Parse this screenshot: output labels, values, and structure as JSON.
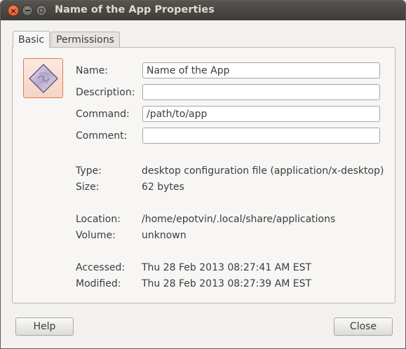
{
  "window": {
    "title": "Name of the App Properties"
  },
  "tabs": [
    {
      "label": "Basic",
      "active": true
    },
    {
      "label": "Permissions",
      "active": false
    }
  ],
  "basic": {
    "fields": {
      "name": {
        "label": "Name:",
        "value": "Name of the App"
      },
      "description": {
        "label": "Description:",
        "value": ""
      },
      "command": {
        "label": "Command:",
        "value": "/path/to/app"
      },
      "comment": {
        "label": "Comment:",
        "value": ""
      }
    },
    "info": {
      "type": {
        "label": "Type:",
        "value": "desktop configuration file (application/x-desktop)"
      },
      "size": {
        "label": "Size:",
        "value": "62 bytes"
      },
      "location": {
        "label": "Location:",
        "value": "/home/epotvin/.local/share/applications"
      },
      "volume": {
        "label": "Volume:",
        "value": "unknown"
      },
      "accessed": {
        "label": "Accessed:",
        "value": "Thu 28 Feb 2013 08:27:41 AM EST"
      },
      "modified": {
        "label": "Modified:",
        "value": "Thu 28 Feb 2013 08:27:39 AM EST"
      }
    },
    "icon": "app-launcher-icon"
  },
  "buttons": {
    "help": "Help",
    "close": "Close"
  },
  "colors": {
    "titlebar": "#3d3c38",
    "close_button": "#e0521f",
    "icon_border": "#e07b52"
  }
}
